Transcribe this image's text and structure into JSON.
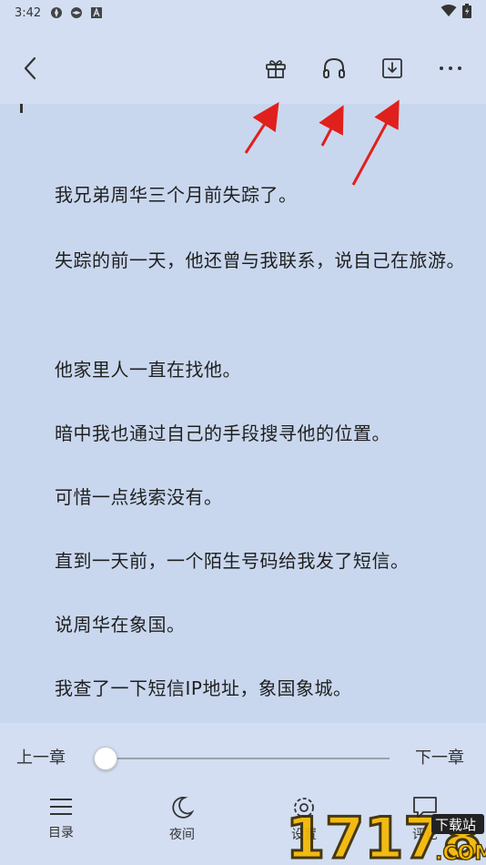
{
  "status": {
    "time": "3:42"
  },
  "toolbar": {
    "back_icon": "back-arrow-icon",
    "gift_icon": "gift-icon",
    "audio_icon": "headphones-icon",
    "download_icon": "download-icon",
    "more_icon": "more-dots-icon"
  },
  "content": {
    "paragraphs": [
      "我兄弟周华三个月前失踪了。",
      "失踪的前一天，他还曾与我联系，说自己在旅游。",
      "他家里人一直在找他。",
      "暗中我也通过自己的手段搜寻他的位置。",
      "可惜一点线索没有。",
      "直到一天前，一个陌生号码给我发了短信。",
      "说周华在象国。",
      "我查了一下短信IP地址，象国象城。"
    ]
  },
  "reader": {
    "prev_chapter": "上一章",
    "next_chapter": "下一章",
    "progress": 0
  },
  "bottom_nav": [
    {
      "label": "目录",
      "icon": "list-icon"
    },
    {
      "label": "夜间",
      "icon": "moon-icon"
    },
    {
      "label": "设置",
      "icon": "settings-icon"
    },
    {
      "label": "评论",
      "icon": "comment-icon"
    }
  ],
  "watermark": {
    "text": "17178",
    "sub": "下载站",
    "domain": ".COM"
  },
  "colors": {
    "background": "#c9d7ee",
    "bar": "#d3def2",
    "arrow": "#e0201c"
  }
}
